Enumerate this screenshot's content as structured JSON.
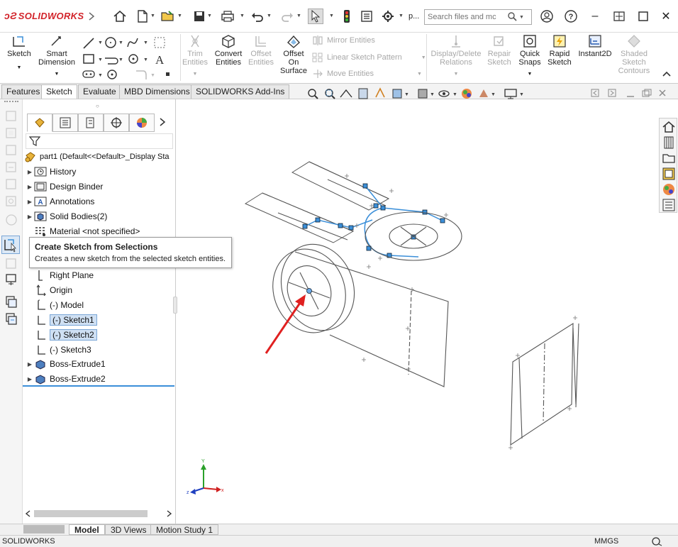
{
  "app": {
    "logo_text": "SOLIDWORKS",
    "search_placeholder": "Search files and mc",
    "doc_short": "p..."
  },
  "command_manager": {
    "sketch": "Sketch",
    "smart_dimension_1": "Smart",
    "smart_dimension_2": "Dimension",
    "trim_1": "Trim",
    "trim_2": "Entities",
    "convert_1": "Convert",
    "convert_2": "Entities",
    "offset_1": "Offset",
    "offset_2": "Entities",
    "offset_surface_1": "Offset",
    "offset_surface_2": "On",
    "offset_surface_3": "Surface",
    "mirror": "Mirror Entities",
    "linear_pattern": "Linear Sketch Pattern",
    "move": "Move Entities",
    "display_delete_1": "Display/Delete",
    "display_delete_2": "Relations",
    "repair_1": "Repair",
    "repair_2": "Sketch",
    "quick_snaps_1": "Quick",
    "quick_snaps_2": "Snaps",
    "rapid_1": "Rapid",
    "rapid_2": "Sketch",
    "instant2d": "Instant2D",
    "shaded_1": "Shaded",
    "shaded_2": "Sketch",
    "shaded_3": "Contours"
  },
  "tabs": [
    "Features",
    "Sketch",
    "Evaluate",
    "MBD Dimensions",
    "SOLIDWORKS Add-Ins"
  ],
  "tree": {
    "root": "part1  (Default<<Default>_Display Sta",
    "items": [
      "History",
      "Design Binder",
      "Annotations",
      "Solid Bodies(2)",
      "Material <not specified>",
      "Right Plane",
      "Origin",
      "(-) Model",
      "(-) Sketch1",
      "(-) Sketch2",
      "(-) Sketch3",
      "Boss-Extrude1",
      "Boss-Extrude2"
    ]
  },
  "tooltip": {
    "title": "Create Sketch from Selections",
    "desc": "Creates a new sketch from the selected sketch entities."
  },
  "bottom_tabs": [
    "Model",
    "3D Views",
    "Motion Study 1"
  ],
  "status": {
    "left": "SOLIDWORKS",
    "units": "MMGS"
  },
  "triad": {
    "x": "x",
    "y": "Y",
    "z": "z"
  },
  "colors": {
    "brand": "#d2232a",
    "accent": "#3b8fd9",
    "arrow": "#e02020",
    "selection": "#cfe0f3"
  }
}
